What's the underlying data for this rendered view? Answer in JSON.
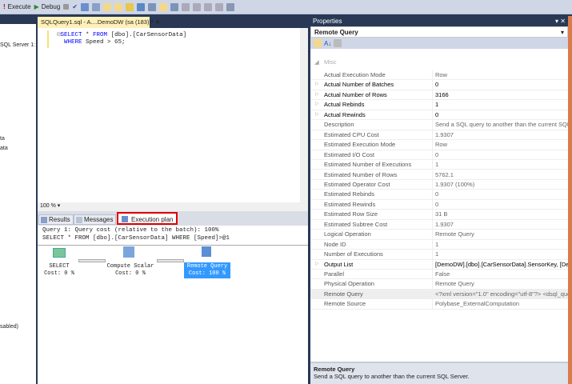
{
  "toolbar": {
    "execute": "Execute",
    "debug": "Debug"
  },
  "left_panel": {
    "items": [
      "SQL Server 1:",
      "ta",
      "ata",
      "sabled)"
    ]
  },
  "doc_tab": {
    "title": "SQLQuery1.sql - A....DemoDW (sa (183))*"
  },
  "editor": {
    "line1": {
      "kw1": "SELECT",
      "rest1": " * ",
      "kw2": "FROM",
      "rest2": " [dbo].[CarSensorData]"
    },
    "line2": {
      "kw": "WHERE",
      "rest": " Speed > 65;"
    }
  },
  "zoom": "100 %",
  "results_tabs": [
    {
      "label": "Results"
    },
    {
      "label": "Messages"
    },
    {
      "label": "Execution plan"
    }
  ],
  "plan": {
    "line1": "Query 1: Query cost (relative to the batch): 100%",
    "line2": "SELECT * FROM [dbo].[CarSensorData] WHERE [Speed]>@1",
    "nodes": [
      {
        "name": "SELECT",
        "cost": "Cost: 0 %"
      },
      {
        "name": "Compute Scalar",
        "cost": "Cost: 0 %"
      },
      {
        "name": "Remote Query",
        "cost": "Cost: 100 %"
      }
    ]
  },
  "properties": {
    "title": "Properties",
    "object": "Remote Query",
    "category": "Misc",
    "rows": [
      {
        "name": "Actual Execution Mode",
        "value": "Row",
        "bold": false,
        "expand": false
      },
      {
        "name": "Actual Number of Batches",
        "value": "0",
        "bold": true,
        "expand": true
      },
      {
        "name": "Actual Number of Rows",
        "value": "3166",
        "bold": true,
        "expand": true
      },
      {
        "name": "Actual Rebinds",
        "value": "1",
        "bold": true,
        "expand": true
      },
      {
        "name": "Actual Rewinds",
        "value": "0",
        "bold": true,
        "expand": true
      },
      {
        "name": "Description",
        "value": "Send a SQL query to another than the current SQL Server.",
        "bold": false,
        "expand": false
      },
      {
        "name": "Estimated CPU Cost",
        "value": "1.9307",
        "bold": false,
        "expand": false
      },
      {
        "name": "Estimated Execution Mode",
        "value": "Row",
        "bold": false,
        "expand": false
      },
      {
        "name": "Estimated I/O Cost",
        "value": "0",
        "bold": false,
        "expand": false
      },
      {
        "name": "Estimated Number of Executions",
        "value": "1",
        "bold": false,
        "expand": false
      },
      {
        "name": "Estimated Number of Rows",
        "value": "5762.1",
        "bold": false,
        "expand": false
      },
      {
        "name": "Estimated Operator Cost",
        "value": "1.9307 (100%)",
        "bold": false,
        "expand": false
      },
      {
        "name": "Estimated Rebinds",
        "value": "0",
        "bold": false,
        "expand": false
      },
      {
        "name": "Estimated Rewinds",
        "value": "0",
        "bold": false,
        "expand": false
      },
      {
        "name": "Estimated Row Size",
        "value": "31 B",
        "bold": false,
        "expand": false
      },
      {
        "name": "Estimated Subtree Cost",
        "value": "1.9307",
        "bold": false,
        "expand": false
      },
      {
        "name": "Logical Operation",
        "value": "Remote Query",
        "bold": false,
        "expand": false
      },
      {
        "name": "Node ID",
        "value": "1",
        "bold": false,
        "expand": false
      },
      {
        "name": "Number of Executions",
        "value": "1",
        "bold": false,
        "expand": false
      },
      {
        "name": "Output List",
        "value": "[DemoDW].[dbo].[CarSensorData].SensorKey, [DemoDW]",
        "bold": true,
        "expand": true
      },
      {
        "name": "Parallel",
        "value": "False",
        "bold": false,
        "expand": false
      },
      {
        "name": "Physical Operation",
        "value": "Remote Query",
        "bold": false,
        "expand": false
      },
      {
        "name": "Remote Query",
        "value": "<?xml version=\"1.0\" encoding=\"utf-8\"?> <dsql_query>",
        "bold": false,
        "expand": false,
        "selected": true
      },
      {
        "name": "Remote Source",
        "value": "Polybase_ExternalComputation",
        "bold": false,
        "expand": false
      }
    ],
    "desc_title": "Remote Query",
    "desc_text": "Send a SQL query to another than the current SQL Server."
  },
  "colors": {
    "frame": "#293955",
    "highlight": "#3399ff",
    "tab_outline": "#e00000"
  }
}
